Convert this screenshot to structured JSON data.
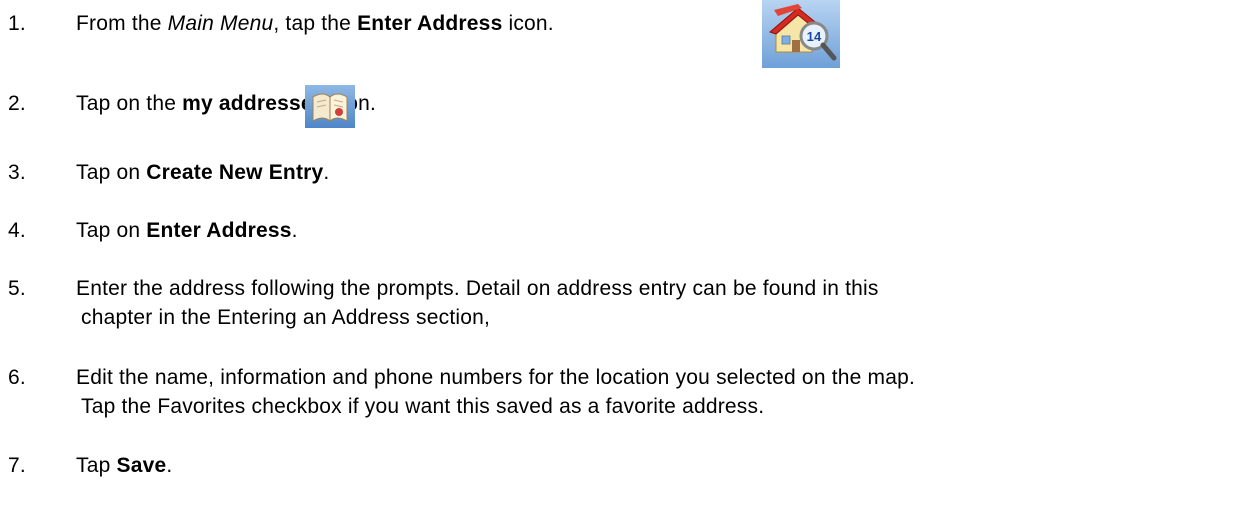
{
  "steps": [
    {
      "num": "1.",
      "before": "From the ",
      "em": "Main Menu",
      "mid": ", tap the ",
      "bold": "Enter Address",
      "after": " icon."
    },
    {
      "num": "2.",
      "before": "Tap on the ",
      "bold": "my addresses",
      "after": " icon."
    },
    {
      "num": "3.",
      "before": "Tap on ",
      "bold": "Create New Entry",
      "after": "."
    },
    {
      "num": "4.",
      "before": "Tap on ",
      "bold": "Enter Address",
      "after": "."
    },
    {
      "num": "5.",
      "line1": "Enter the address following the prompts.  Detail on address entry can be found in this",
      "line2": "chapter in the Entering an Address section,"
    },
    {
      "num": "6.",
      "line1": "Edit the name, information and phone numbers for the location you selected on the map.",
      "line2": "Tap the Favorites checkbox if you want this saved as a favorite address."
    },
    {
      "num": "7.",
      "before": "Tap ",
      "bold": "Save",
      "after": "."
    }
  ],
  "icons": {
    "enter_address": {
      "badge": "14"
    }
  }
}
